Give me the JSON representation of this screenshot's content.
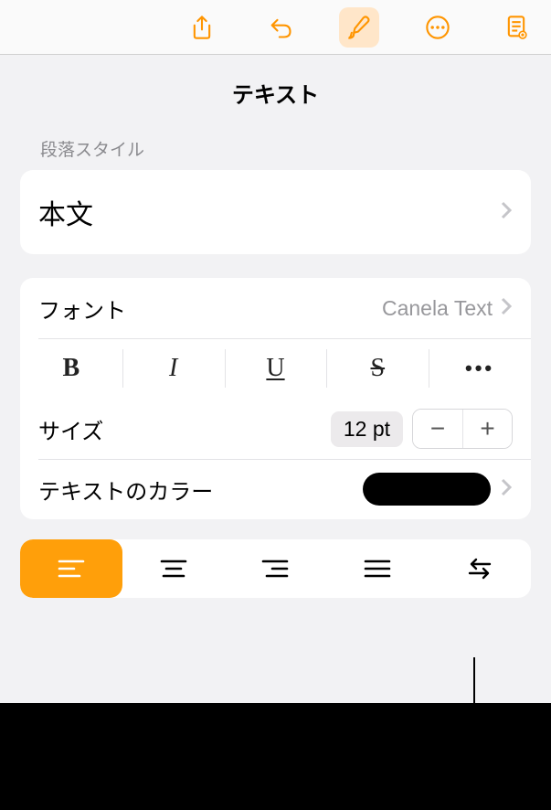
{
  "panel": {
    "title": "テキスト"
  },
  "paragraph": {
    "section_label": "段落スタイル",
    "style_name": "本文"
  },
  "font": {
    "label": "フォント",
    "value": "Canela Text"
  },
  "style_buttons": {
    "bold": "B",
    "italic": "I",
    "underline": "U",
    "strike": "S",
    "more": "•••"
  },
  "size": {
    "label": "サイズ",
    "value": "12 pt",
    "minus": "−",
    "plus": "+"
  },
  "text_color": {
    "label": "テキストのカラー",
    "value_hex": "#000000"
  },
  "toolbar_icons": {
    "share": "share-icon",
    "undo": "undo-icon",
    "format": "format-brush-icon",
    "more": "more-circle-icon",
    "document": "document-icon"
  }
}
